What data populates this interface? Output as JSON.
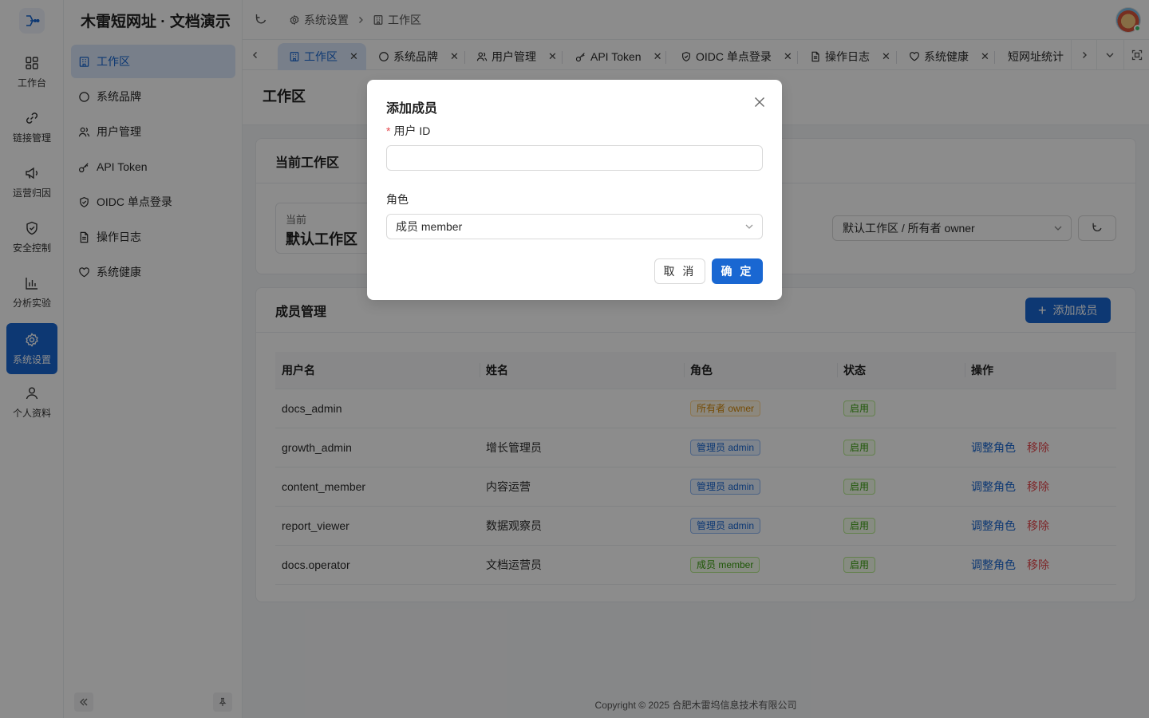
{
  "colors": {
    "primary": "#1967d2",
    "danger": "#e5484d",
    "owner": "#d48806",
    "success": "#389e0d"
  },
  "rail": {
    "items": [
      {
        "label": "工作台",
        "icon": "dashboard-icon"
      },
      {
        "label": "链接管理",
        "icon": "link-icon"
      },
      {
        "label": "运营归因",
        "icon": "megaphone-icon"
      },
      {
        "label": "安全控制",
        "icon": "shield-icon"
      },
      {
        "label": "分析实验",
        "icon": "bar-chart-icon"
      },
      {
        "label": "系统设置",
        "icon": "gear-icon",
        "active": true
      },
      {
        "label": "个人资料",
        "icon": "user-icon"
      }
    ]
  },
  "sidebar": {
    "title": "木雷短网址 · 文档演示",
    "items": [
      {
        "label": "工作区",
        "icon": "building-icon",
        "active": true
      },
      {
        "label": "系统品牌",
        "icon": "circle-icon"
      },
      {
        "label": "用户管理",
        "icon": "users-icon"
      },
      {
        "label": "API Token",
        "icon": "key-icon"
      },
      {
        "label": "OIDC 单点登录",
        "icon": "shield-check-icon"
      },
      {
        "label": "操作日志",
        "icon": "document-icon"
      },
      {
        "label": "系统健康",
        "icon": "heart-icon"
      }
    ]
  },
  "header": {
    "breadcrumb": [
      "系统设置",
      "工作区"
    ]
  },
  "tabs": [
    {
      "label": "工作区",
      "icon": "building-icon",
      "active": true,
      "closable": true
    },
    {
      "label": "系统品牌",
      "icon": "circle-icon",
      "closable": true
    },
    {
      "label": "用户管理",
      "icon": "users-icon",
      "closable": true
    },
    {
      "label": "API Token",
      "icon": "key-icon",
      "closable": true
    },
    {
      "label": "OIDC 单点登录",
      "icon": "shield-check-icon",
      "closable": true
    },
    {
      "label": "操作日志",
      "icon": "document-icon",
      "closable": true
    },
    {
      "label": "系统健康",
      "icon": "heart-icon",
      "closable": true
    },
    {
      "label": "短网址统计",
      "icon": "",
      "closable": false
    }
  ],
  "page": {
    "title": "工作区",
    "current_card": {
      "title": "当前工作区",
      "current_label": "当前",
      "current_value": "默认工作区",
      "workspace_select": "默认工作区 / 所有者 owner"
    },
    "members_card": {
      "title": "成员管理",
      "add_button": "添加成员",
      "columns": [
        "用户名",
        "姓名",
        "角色",
        "状态",
        "操作"
      ],
      "rows": [
        {
          "username": "docs_admin",
          "name": "",
          "role": "所有者 owner",
          "role_type": "owner",
          "status": "启用",
          "actions": []
        },
        {
          "username": "growth_admin",
          "name": "增长管理员",
          "role": "管理员 admin",
          "role_type": "admin",
          "status": "启用",
          "actions": [
            "调整角色",
            "移除"
          ]
        },
        {
          "username": "content_member",
          "name": "内容运营",
          "role": "管理员 admin",
          "role_type": "admin",
          "status": "启用",
          "actions": [
            "调整角色",
            "移除"
          ]
        },
        {
          "username": "report_viewer",
          "name": "数据观察员",
          "role": "管理员 admin",
          "role_type": "admin",
          "status": "启用",
          "actions": [
            "调整角色",
            "移除"
          ]
        },
        {
          "username": "docs.operator",
          "name": "文档运营员",
          "role": "成员 member",
          "role_type": "member",
          "status": "启用",
          "actions": [
            "调整角色",
            "移除"
          ]
        }
      ]
    }
  },
  "footer": {
    "copyright": "Copyright © 2025 合肥木雷坞信息技术有限公司"
  },
  "modal": {
    "title": "添加成员",
    "user_id_label": "用户 ID",
    "user_id_required_mark": "*",
    "user_id_value": "",
    "role_label": "角色",
    "role_value": "成员 member",
    "cancel_label": "取 消",
    "ok_label": "确 定"
  }
}
